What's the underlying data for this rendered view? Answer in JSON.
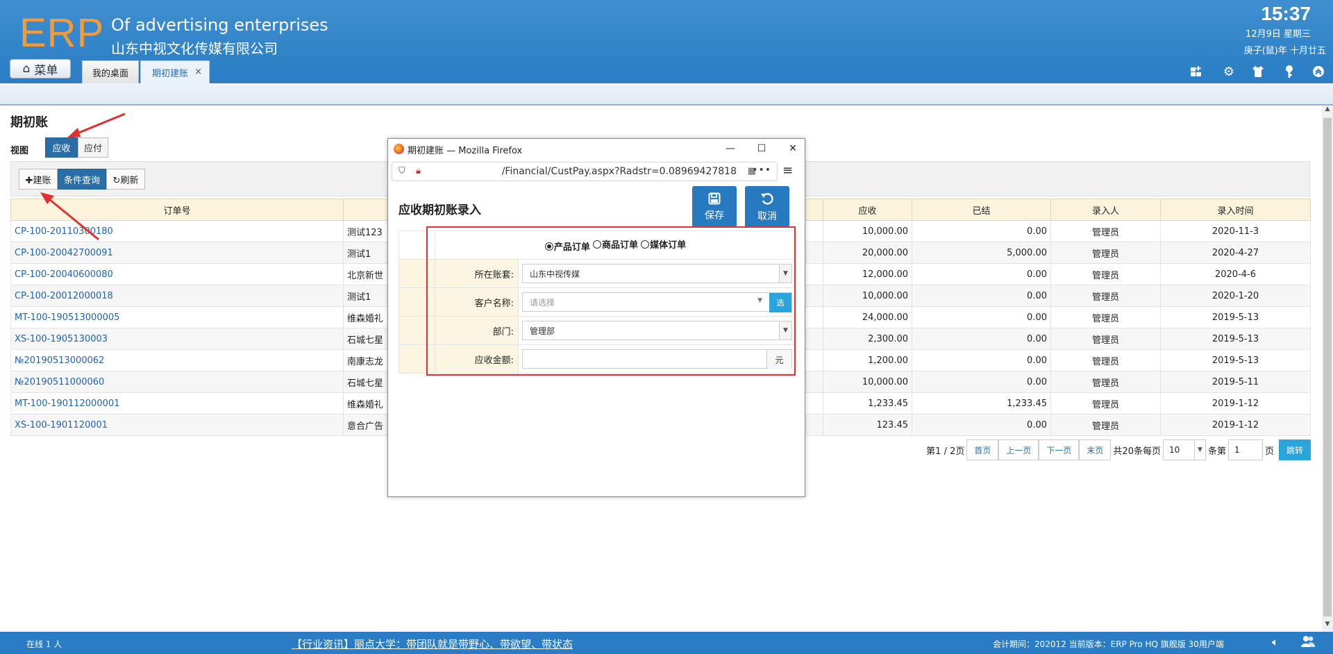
{
  "header": {
    "logo": "ERP",
    "app_name": "Of advertising enterprises",
    "company": "山东中视文化传媒有限公司",
    "time": "15:37",
    "date": "12月9日 星期三",
    "lunar": "庚子(鼠)年 十月廿五",
    "menu_label": "菜单",
    "tabs": [
      {
        "label": "我的桌面"
      },
      {
        "label": "期初建账",
        "close": "×"
      }
    ],
    "icons": [
      "dashboard-icon",
      "settings-icon",
      "shirt-icon",
      "key-icon",
      "collapse-icon"
    ]
  },
  "main": {
    "title": "期初账",
    "view_label": "视图",
    "view_buttons": {
      "receivable": "应收",
      "payable": "应付"
    },
    "toolbar": {
      "new": "✚建账",
      "query": "条件查询",
      "refresh": "↻刷新"
    },
    "columns": [
      "订单号",
      "",
      "",
      "应收",
      "已结",
      "录入人",
      "录入时间"
    ],
    "rows": [
      {
        "order": "CP-100-20110300180",
        "customer": "测试123",
        "recv": "10,000.00",
        "settled": "0.00",
        "user": "管理员",
        "time": "2020-11-3"
      },
      {
        "order": "CP-100-20042700091",
        "customer": "测试1",
        "recv": "20,000.00",
        "settled": "5,000.00",
        "user": "管理员",
        "time": "2020-4-27"
      },
      {
        "order": "CP-100-20040600080",
        "customer": "北京新世",
        "recv": "12,000.00",
        "settled": "0.00",
        "user": "管理员",
        "time": "2020-4-6"
      },
      {
        "order": "CP-100-20012000018",
        "customer": "测试1",
        "recv": "10,000.00",
        "settled": "0.00",
        "user": "管理员",
        "time": "2020-1-20"
      },
      {
        "order": "MT-100-190513000005",
        "customer": "维森婚礼",
        "recv": "24,000.00",
        "settled": "0.00",
        "user": "管理员",
        "time": "2019-5-13"
      },
      {
        "order": "XS-100-1905130003",
        "customer": "石城七星",
        "recv": "2,300.00",
        "settled": "0.00",
        "user": "管理员",
        "time": "2019-5-13"
      },
      {
        "order": "№20190513000062",
        "customer": "南康志龙",
        "recv": "1,200.00",
        "settled": "0.00",
        "user": "管理员",
        "time": "2019-5-13"
      },
      {
        "order": "№20190511000060",
        "customer": "石城七星",
        "recv": "10,000.00",
        "settled": "0.00",
        "user": "管理员",
        "time": "2019-5-11"
      },
      {
        "order": "MT-100-190112000001",
        "customer": "维森婚礼",
        "recv": "1,233.45",
        "settled": "1,233.45",
        "user": "管理员",
        "time": "2019-1-12"
      },
      {
        "order": "XS-100-1901120001",
        "customer": "意合广告",
        "recv": "123.45",
        "settled": "0.00",
        "user": "管理员",
        "time": "2019-1-12"
      }
    ],
    "pager": {
      "page_info": "第1 / 2页",
      "first": "首页",
      "prev": "上一页",
      "next": "下一页",
      "last": "末页",
      "total": "共20条每页",
      "page_size": "10",
      "per_unit": "条第",
      "page_input": "1",
      "page_unit": "页",
      "go": "跳转"
    }
  },
  "modal": {
    "window_title": "期初建账 — Mozilla Firefox",
    "url": "/Financial/CustPay.aspx?Radstr=0.08969427818",
    "heading": "应收期初账录入",
    "save": "保存",
    "cancel": "取消",
    "radios": [
      {
        "label": "产品订单",
        "checked": true
      },
      {
        "label": "商品订单",
        "checked": false
      },
      {
        "label": "媒体订单",
        "checked": false
      }
    ],
    "fields": {
      "account_label": "所在账套:",
      "account_value": "山东中视传媒",
      "customer_label": "客户名称:",
      "customer_placeholder": "请选择",
      "select_btn": "选",
      "dept_label": "部门:",
      "dept_value": "管理部",
      "amount_label": "应收金额:",
      "amount_value": "",
      "amount_unit": "元"
    }
  },
  "status": {
    "online": "在线  1  人",
    "news": "【行业资讯】丽点大学：带团队就是带野心、带欲望、带状态",
    "version": "会计期间：202012 当前版本：ERP Pro HQ 旗舰版 30用户端"
  },
  "colors": {
    "header": "#2a7dc4",
    "accent": "#2a6ea8",
    "logo": "#f39b3a",
    "annotation": "#e03030"
  }
}
